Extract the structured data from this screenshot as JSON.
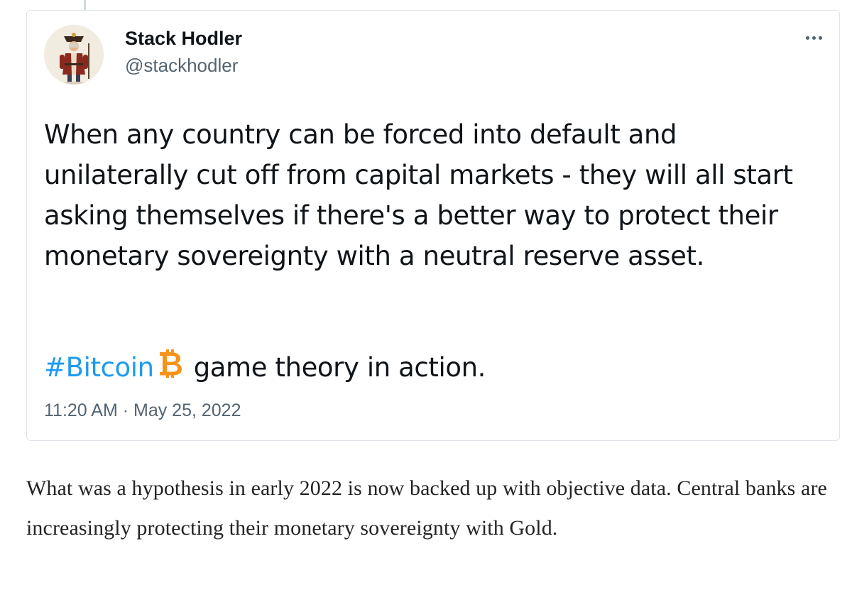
{
  "tweet": {
    "author_name": "Stack Hodler",
    "author_handle": "@stackhodler",
    "more_icon": "more-horizontal-icon",
    "body": "When any country can be forced into default and unilaterally cut off from capital markets - they will all start asking themselves if there's a better way to protect their monetary sovereignty with a neutral reserve asset.",
    "hashtag": "#Bitcoin",
    "bitcoin_emoji_icon": "bitcoin-icon",
    "trailing_text": "game theory in action.",
    "timestamp": "11:20 AM · May 25, 2022",
    "colors": {
      "hashtag": "#1d9bf0",
      "bitcoin": "#f7931a",
      "text": "#0f1419",
      "muted": "#536471"
    }
  },
  "article": {
    "paragraph": "What was a hypothesis in early 2022 is now backed up with objective data. Central banks are increasingly protecting their monetary sovereignty with Gold."
  }
}
